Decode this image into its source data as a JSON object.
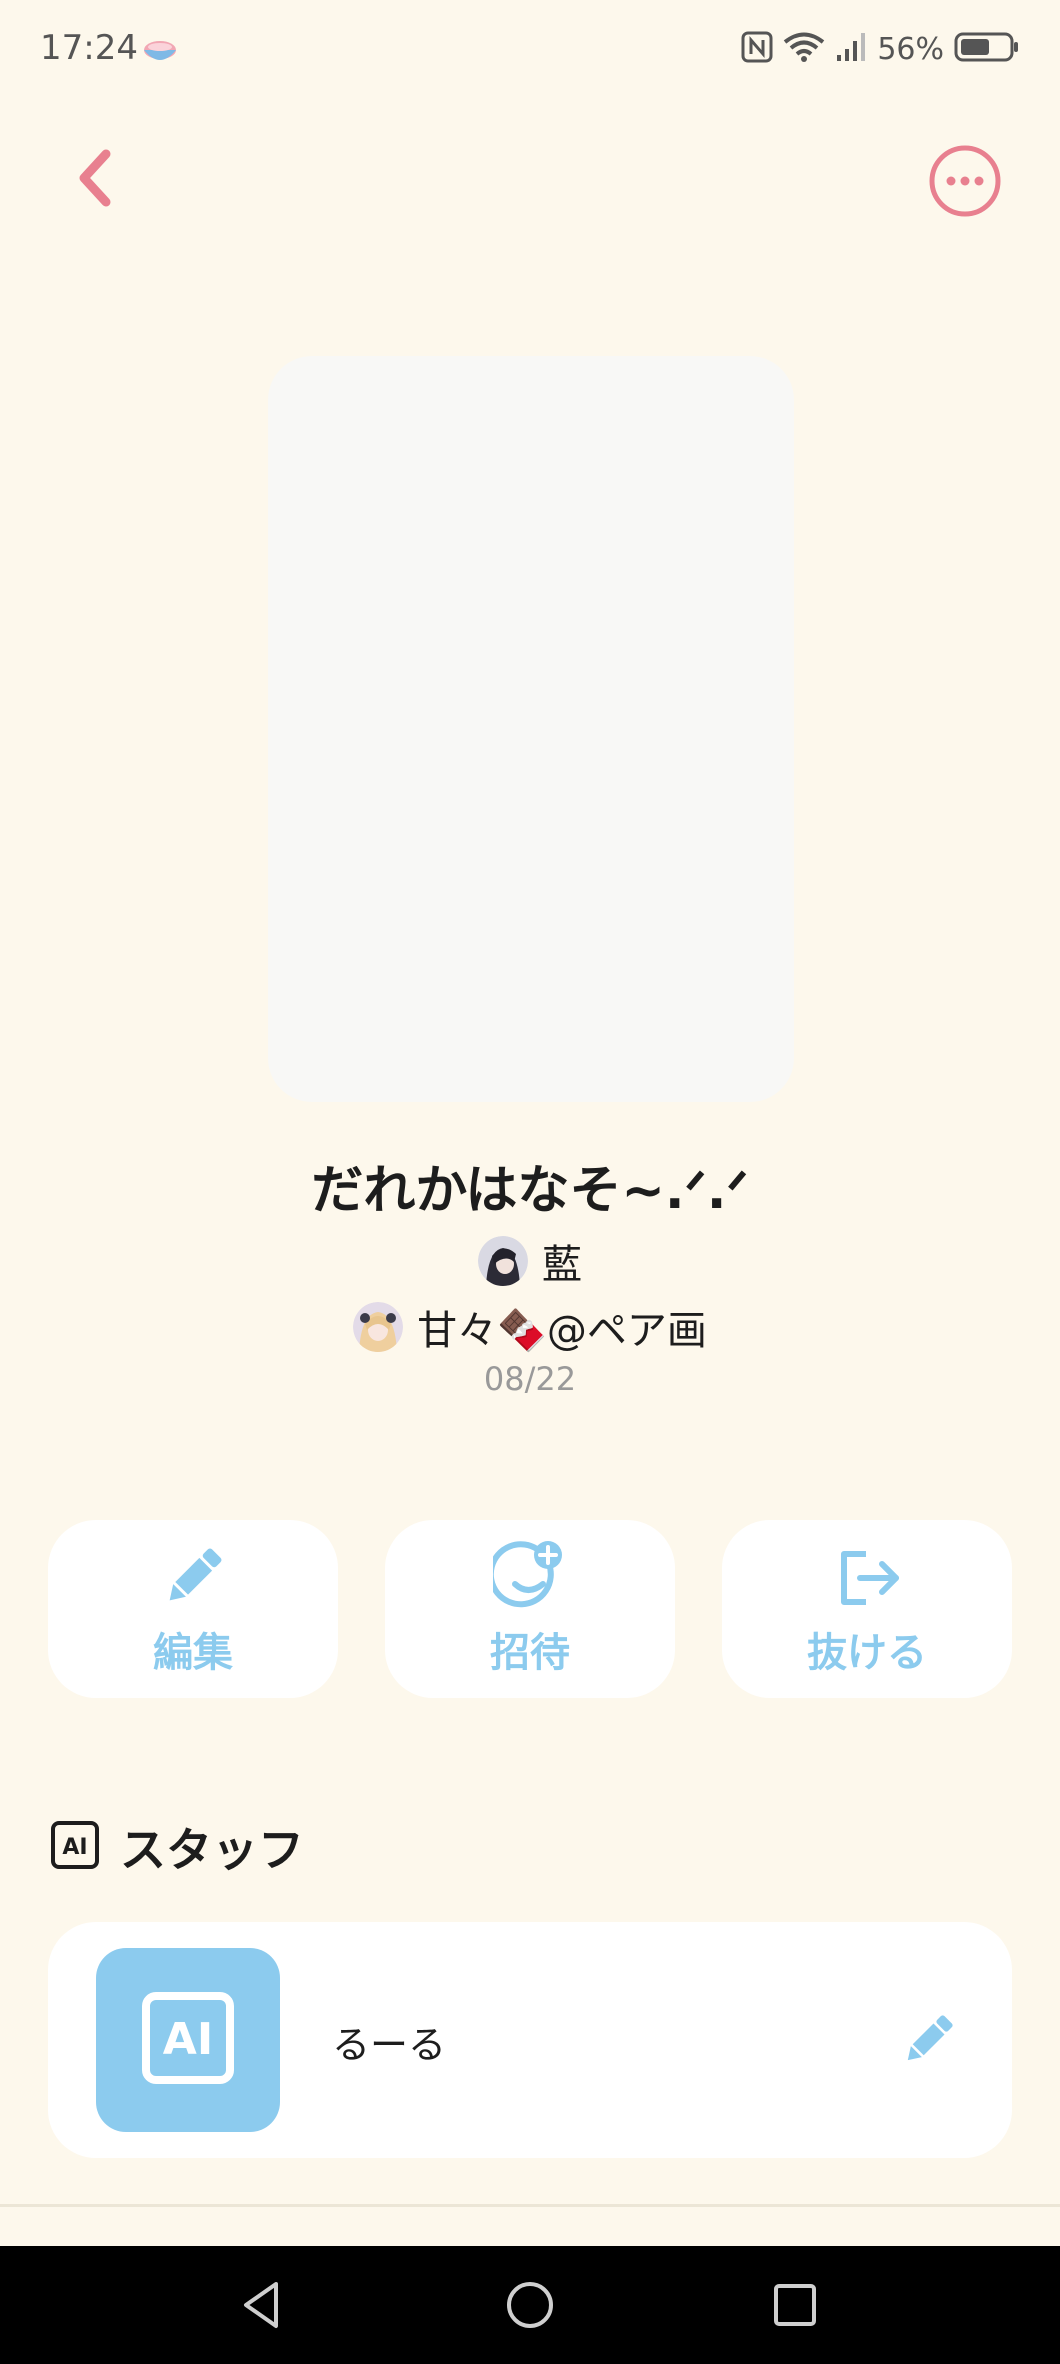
{
  "status_bar": {
    "time": "17:24",
    "battery_percent": "56%",
    "icons": [
      "teacup-icon",
      "nfc-icon",
      "wifi-icon",
      "signal-icon",
      "battery-icon"
    ]
  },
  "header": {
    "back_icon": "chevron-left-icon",
    "more_icon": "more-horizontal-icon"
  },
  "room": {
    "title": "だれかはなそ~.ᐟ.ᐟ",
    "members": [
      {
        "name": "藍"
      },
      {
        "name": "甘々🍫@ペア画"
      }
    ],
    "date": "08/22"
  },
  "actions": [
    {
      "label": "編集",
      "icon": "pencil-icon"
    },
    {
      "label": "招待",
      "icon": "add-friend-icon"
    },
    {
      "label": "抜ける",
      "icon": "exit-icon"
    }
  ],
  "staff_section": {
    "title": "スタッフ",
    "icon": "ai-icon",
    "items": [
      {
        "name": "るーる",
        "edit_icon": "pencil-icon"
      }
    ]
  },
  "colors": {
    "background": "#fdf8ec",
    "accent_pink": "#e8808f",
    "accent_blue": "#8ccbee",
    "card": "#ffffff"
  }
}
